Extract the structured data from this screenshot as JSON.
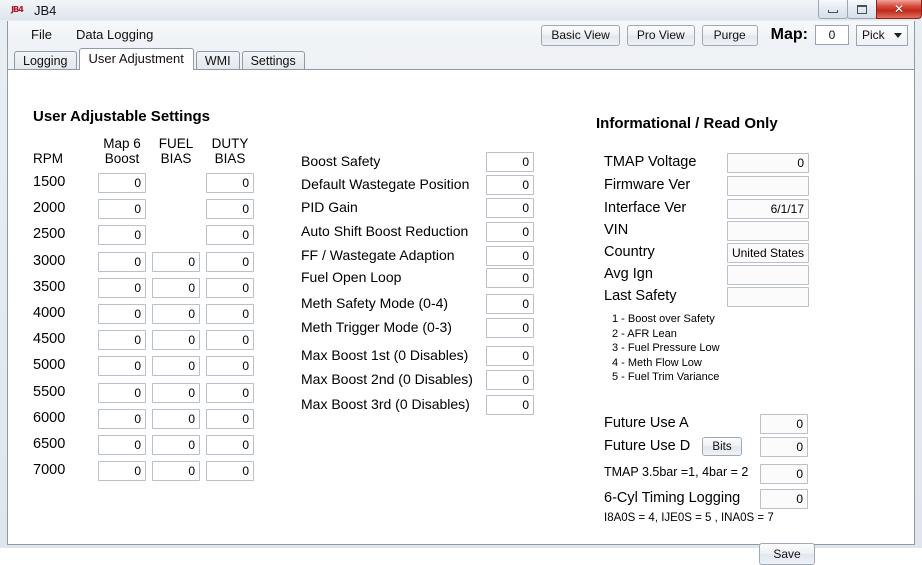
{
  "window": {
    "title": "JB4",
    "icon": "jb4-logo-icon",
    "buttons": {
      "minimize": "minimize-icon",
      "maximize": "maximize-icon",
      "close": "✕"
    }
  },
  "menubar": {
    "items": [
      {
        "label": "File"
      },
      {
        "label": "Data Logging"
      }
    ]
  },
  "toolbar": {
    "buttons": [
      {
        "label": "Basic View"
      },
      {
        "label": "Pro View"
      },
      {
        "label": "Purge"
      }
    ],
    "map_label": "Map:",
    "map_value": "0",
    "pick_selected": "Pick",
    "pick_options": [
      "Pick"
    ]
  },
  "tabs": [
    {
      "label": "Logging",
      "active": false
    },
    {
      "label": "User Adjustment",
      "active": true
    },
    {
      "label": "WMI",
      "active": false
    },
    {
      "label": "Settings",
      "active": false
    }
  ],
  "left_panel": {
    "title": "User Adjustable Settings",
    "columns": [
      {
        "key": "rpm",
        "head_line1": "",
        "head_line2": "RPM"
      },
      {
        "key": "map6boost",
        "head_line1": "Map 6",
        "head_line2": "Boost"
      },
      {
        "key": "fuelbias",
        "head_line1": "FUEL",
        "head_line2": "BIAS"
      },
      {
        "key": "dutybias",
        "head_line1": "DUTY",
        "head_line2": "BIAS"
      }
    ],
    "rows": [
      {
        "rpm": "1500",
        "map6boost": "0",
        "fuelbias": null,
        "dutybias": "0"
      },
      {
        "rpm": "2000",
        "map6boost": "0",
        "fuelbias": null,
        "dutybias": "0"
      },
      {
        "rpm": "2500",
        "map6boost": "0",
        "fuelbias": null,
        "dutybias": "0"
      },
      {
        "rpm": "3000",
        "map6boost": "0",
        "fuelbias": "0",
        "dutybias": "0"
      },
      {
        "rpm": "3500",
        "map6boost": "0",
        "fuelbias": "0",
        "dutybias": "0"
      },
      {
        "rpm": "4000",
        "map6boost": "0",
        "fuelbias": "0",
        "dutybias": "0"
      },
      {
        "rpm": "4500",
        "map6boost": "0",
        "fuelbias": "0",
        "dutybias": "0"
      },
      {
        "rpm": "5000",
        "map6boost": "0",
        "fuelbias": "0",
        "dutybias": "0"
      },
      {
        "rpm": "5500",
        "map6boost": "0",
        "fuelbias": "0",
        "dutybias": "0"
      },
      {
        "rpm": "6000",
        "map6boost": "0",
        "fuelbias": "0",
        "dutybias": "0"
      },
      {
        "rpm": "6500",
        "map6boost": "0",
        "fuelbias": "0",
        "dutybias": "0"
      },
      {
        "rpm": "7000",
        "map6boost": "0",
        "fuelbias": "0",
        "dutybias": "0"
      }
    ]
  },
  "middle_panel": {
    "fields": [
      {
        "label": "Boost Safety",
        "value": "0"
      },
      {
        "label": "Default Wastegate Position",
        "value": "0"
      },
      {
        "label": "PID Gain",
        "value": "0"
      },
      {
        "label": "Auto Shift Boost Reduction",
        "value": "0"
      },
      {
        "label": "FF / Wastegate Adaption",
        "value": "0"
      },
      {
        "label": "Fuel Open Loop",
        "value": "0"
      },
      {
        "label": "Meth Safety Mode (0-4)",
        "value": "0"
      },
      {
        "label": "Meth Trigger Mode (0-3)",
        "value": "0"
      },
      {
        "label": "Max Boost 1st (0 Disables)",
        "value": "0"
      },
      {
        "label": "Max Boost 2nd (0 Disables)",
        "value": "0"
      },
      {
        "label": "Max Boost 3rd (0 Disables)",
        "value": "0"
      }
    ]
  },
  "right_panel": {
    "title": "Informational / Read Only",
    "fields": [
      {
        "label": "TMAP Voltage",
        "value": "0"
      },
      {
        "label": "Firmware Ver",
        "value": ""
      },
      {
        "label": "Interface Ver",
        "value": "6/1/17"
      },
      {
        "label": "VIN",
        "value": ""
      },
      {
        "label": "Country",
        "value": "United States"
      },
      {
        "label": "Avg Ign",
        "value": ""
      },
      {
        "label": "Last Safety",
        "value": ""
      }
    ],
    "safety_codes": [
      "1 - Boost over Safety",
      "2 - AFR Lean",
      "3 - Fuel Pressure Low",
      "4 - Meth Flow Low",
      "5 - Fuel Trim Variance"
    ],
    "future_fields": [
      {
        "label": "Future Use A",
        "value": "0"
      },
      {
        "label": "Future Use D",
        "value": "0"
      },
      {
        "label": "TMAP 3.5bar =1, 4bar = 2",
        "value": "0"
      },
      {
        "label": "6-Cyl Timing Logging",
        "value": "0"
      }
    ],
    "bits_button": "Bits",
    "note": "I8A0S = 4, IJE0S = 5 , INA0S = 7",
    "save_button": "Save"
  },
  "colors": {
    "accent_red": "#bf2a1c",
    "frame_border": "#8d9aa8",
    "field_border": "#b9c0c7",
    "readonly_bg": "#fbfbfb"
  }
}
